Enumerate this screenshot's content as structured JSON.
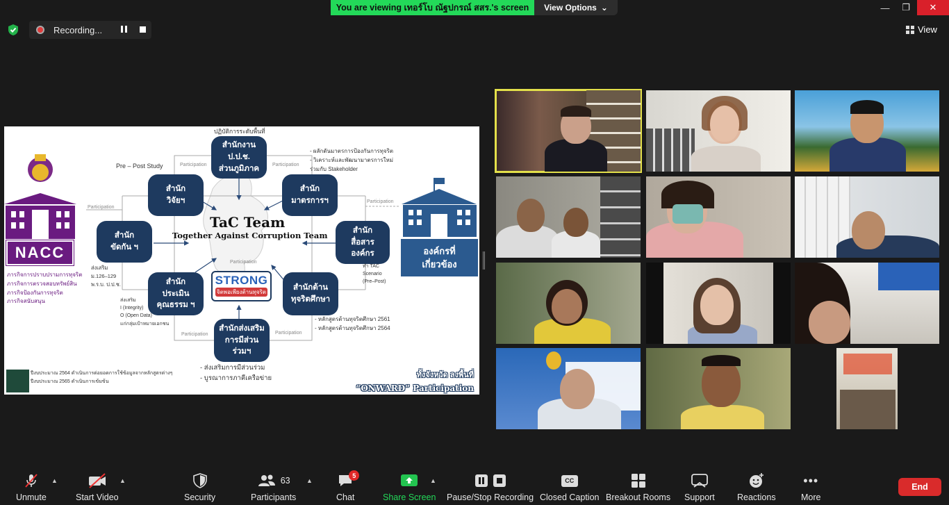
{
  "banner": {
    "text": "You are viewing เทอร์โบ ณัฐปกรณ์ สสร.'s screen",
    "view_options": "View Options"
  },
  "recording": {
    "label": "Recording..."
  },
  "view": {
    "label": "View"
  },
  "slide": {
    "pre_post": "Pre – Post Study",
    "top_label": "ปฏิบัติการระดับพื้นที่",
    "tac_title": "TaC Team",
    "tac_sub": "Together Against Corruption Team",
    "nacc": "NACC",
    "nacc_items": [
      "ภารกิจการปราบปรามการทุจริต",
      "ภารกิจการตรวจสอบทรัพย์สิน",
      "ภารกิจป้องกันการทุจริต",
      "ภารกิจสนับสนุน"
    ],
    "org": "องค์กรที่\nเกี่ยวข้อง",
    "nodes": {
      "regional": "สำนักงาน\nป.ป.ช.\nส่วนภูมิภาค",
      "research": "สำนัก\nวิจัยฯ",
      "measures": "สำนัก\nมาตรการฯ",
      "prevention": "สำนัก\nขัดกัน ฯ",
      "media": "สำนัก\nสื่อสาร\nองค์กร",
      "evaluation": "สำนัก\nประเมิน\nคุณธรรม ฯ",
      "education": "สำนักต้าน\nทุจริตศึกษา",
      "participation": "สำนักส่งเสริม\nการมีส่วน\nร่วมฯ"
    },
    "strong": "STRONG",
    "strong_sub": "จิตพอเพียงต้านทุจริต",
    "participation_word": "Participation",
    "right_notes": "- ผลักดันมาตรการป้องกันการทุจริต\n- วิเคราะห์และพัฒนามาตรการใหม่\nร่วมกับ Stakeholder",
    "media_notes": "ทำ TAC\nScenario\n(Pre–Post)",
    "edu_notes": "- หลักสูตรต้านทุจริตศึกษา 2561\n- หลักสูตรต้านทุจริตศึกษา 2564",
    "part_notes": "- ส่งเสริมการมีส่วนร่วม\n- บูรณาการภาคีเครือข่าย",
    "left_notes1": "ส่งเสริม\nม.126–129\nพ.ร.บ. ป.ป.ช.",
    "left_notes2": "ส่งเสริม\nI (Integrity)\nO (Open Data)\nแก่กลุ่มเป้าหมายเอกชน",
    "onward_th": "ทั้งจังหวัด ลงพื้นที่",
    "onward": "“ONWARD” Participation",
    "footer": "ปีงบประมาณ 2564 ดำเนินการต่อยอดการใช้ข้อมูลจากหลักสูตรต่างๆ\nปีงบประมาณ 2565 ดำเนินการเข้มข้น"
  },
  "toolbar": {
    "unmute": "Unmute",
    "start_video": "Start Video",
    "security": "Security",
    "participants": "Participants",
    "participants_count": "63",
    "chat": "Chat",
    "chat_badge": "5",
    "share_screen": "Share Screen",
    "pause_recording": "Pause/Stop Recording",
    "closed_caption": "Closed Caption",
    "cc_icon": "CC",
    "breakout": "Breakout Rooms",
    "support": "Support",
    "reactions": "Reactions",
    "more": "More",
    "end": "End"
  },
  "colors": {
    "share_green": "#23d959",
    "end_red": "#d92b2b",
    "active_speaker": "#e3e04a",
    "slide_navy": "#1e3a5f",
    "nacc_purple": "#6a1b80"
  }
}
